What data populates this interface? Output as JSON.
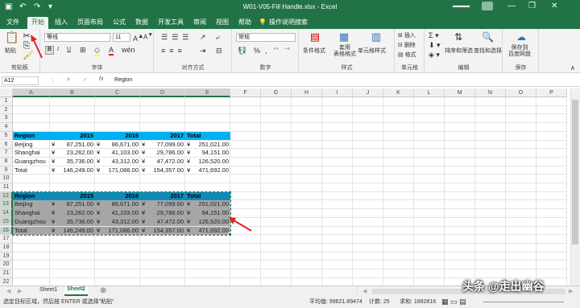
{
  "titlebar": {
    "title": "W01-V05-Fill Handle.xlsx - Excel",
    "min": "—",
    "restore": "❐",
    "close": "✕"
  },
  "tabs": [
    "文件",
    "开始",
    "插入",
    "页面布局",
    "公式",
    "数据",
    "开发工具",
    "审阅",
    "视图",
    "帮助",
    "操作说明搜索"
  ],
  "ribbon": {
    "paste": "粘贴",
    "clipboard": "剪贴板",
    "font_name": "等线",
    "font_size": "11",
    "bold": "B",
    "italic": "I",
    "underline": "U",
    "font_group": "字体",
    "align_group": "对齐方式",
    "number_format": "常规",
    "percent": "%",
    "comma": ",",
    "number_group": "数字",
    "cond_format": "条件格式",
    "table_format": "套用\n表格格式",
    "cell_styles": "单元格样式",
    "styles_group": "样式",
    "insert": "插入",
    "delete": "删除",
    "format": "格式",
    "cells_group": "单元格",
    "sort_filter": "排序和筛选",
    "find_select": "查找和选择",
    "editing_group": "编辑",
    "save_baidu": "保存到\n百度网盘",
    "save_group": "保存"
  },
  "formula_bar": {
    "name_box": "A12",
    "fx": "fx",
    "value": "Region"
  },
  "columns": [
    "A",
    "B",
    "C",
    "D",
    "E",
    "F",
    "G",
    "H",
    "I",
    "J",
    "K",
    "L",
    "M",
    "N",
    "O",
    "P"
  ],
  "rows": [
    "1",
    "2",
    "3",
    "4",
    "5",
    "6",
    "7",
    "8",
    "9",
    "10",
    "11",
    "12",
    "13",
    "14",
    "15",
    "16",
    "17",
    "18",
    "19",
    "20",
    "21",
    "22",
    "23"
  ],
  "table1": {
    "header": [
      "Region",
      "2015",
      "2016",
      "2017",
      "Total"
    ],
    "rows": [
      [
        "Beijing",
        "¥",
        "87,251.00",
        "¥",
        "86,671.00",
        "¥",
        "77,099.00",
        "¥",
        "251,021.00"
      ],
      [
        "Shanghai",
        "¥",
        "23,262.00",
        "¥",
        "41,103.00",
        "¥",
        "29,786.00",
        "¥",
        "94,151.00"
      ],
      [
        "Guangzhou",
        "¥",
        "35,736.00",
        "¥",
        "43,312.00",
        "¥",
        "47,472.00",
        "¥",
        "126,520.00"
      ],
      [
        "Total",
        "¥",
        "146,249.00",
        "¥",
        "171,086.00",
        "¥",
        "154,357.00",
        "¥",
        "471,692.00"
      ]
    ]
  },
  "table2": {
    "header": [
      "Region",
      "2015",
      "2016",
      "2017",
      "Total"
    ],
    "rows": [
      [
        "Beijing",
        "¥",
        "87,251.00",
        "¥",
        "86,671.00",
        "¥",
        "77,099.00",
        "¥",
        "251,021.00"
      ],
      [
        "Shanghai",
        "¥",
        "23,262.00",
        "¥",
        "41,103.00",
        "¥",
        "29,786.00",
        "¥",
        "94,151.00"
      ],
      [
        "Guangzhou",
        "¥",
        "35,736.00",
        "¥",
        "43,312.00",
        "¥",
        "47,472.00",
        "¥",
        "126,520.00"
      ],
      [
        "Total",
        "¥",
        "146,249.00",
        "¥",
        "171,086.00",
        "¥",
        "154,357.00",
        "¥",
        "471,692.00"
      ]
    ]
  },
  "sheets": [
    "Sheet1",
    "Sheet2"
  ],
  "status": {
    "message": "选定目标区域，然后按 ENTER 或选择\"粘贴\"",
    "average": "平均值: 99621.89474",
    "count": "计数: 25",
    "sum": "求和: 1892816"
  },
  "watermark": "头条 @走出幽谷",
  "colors": {
    "excel_green": "#217346",
    "header_blue": "#00b0f0",
    "selection_gray": "#a6a6a6"
  }
}
